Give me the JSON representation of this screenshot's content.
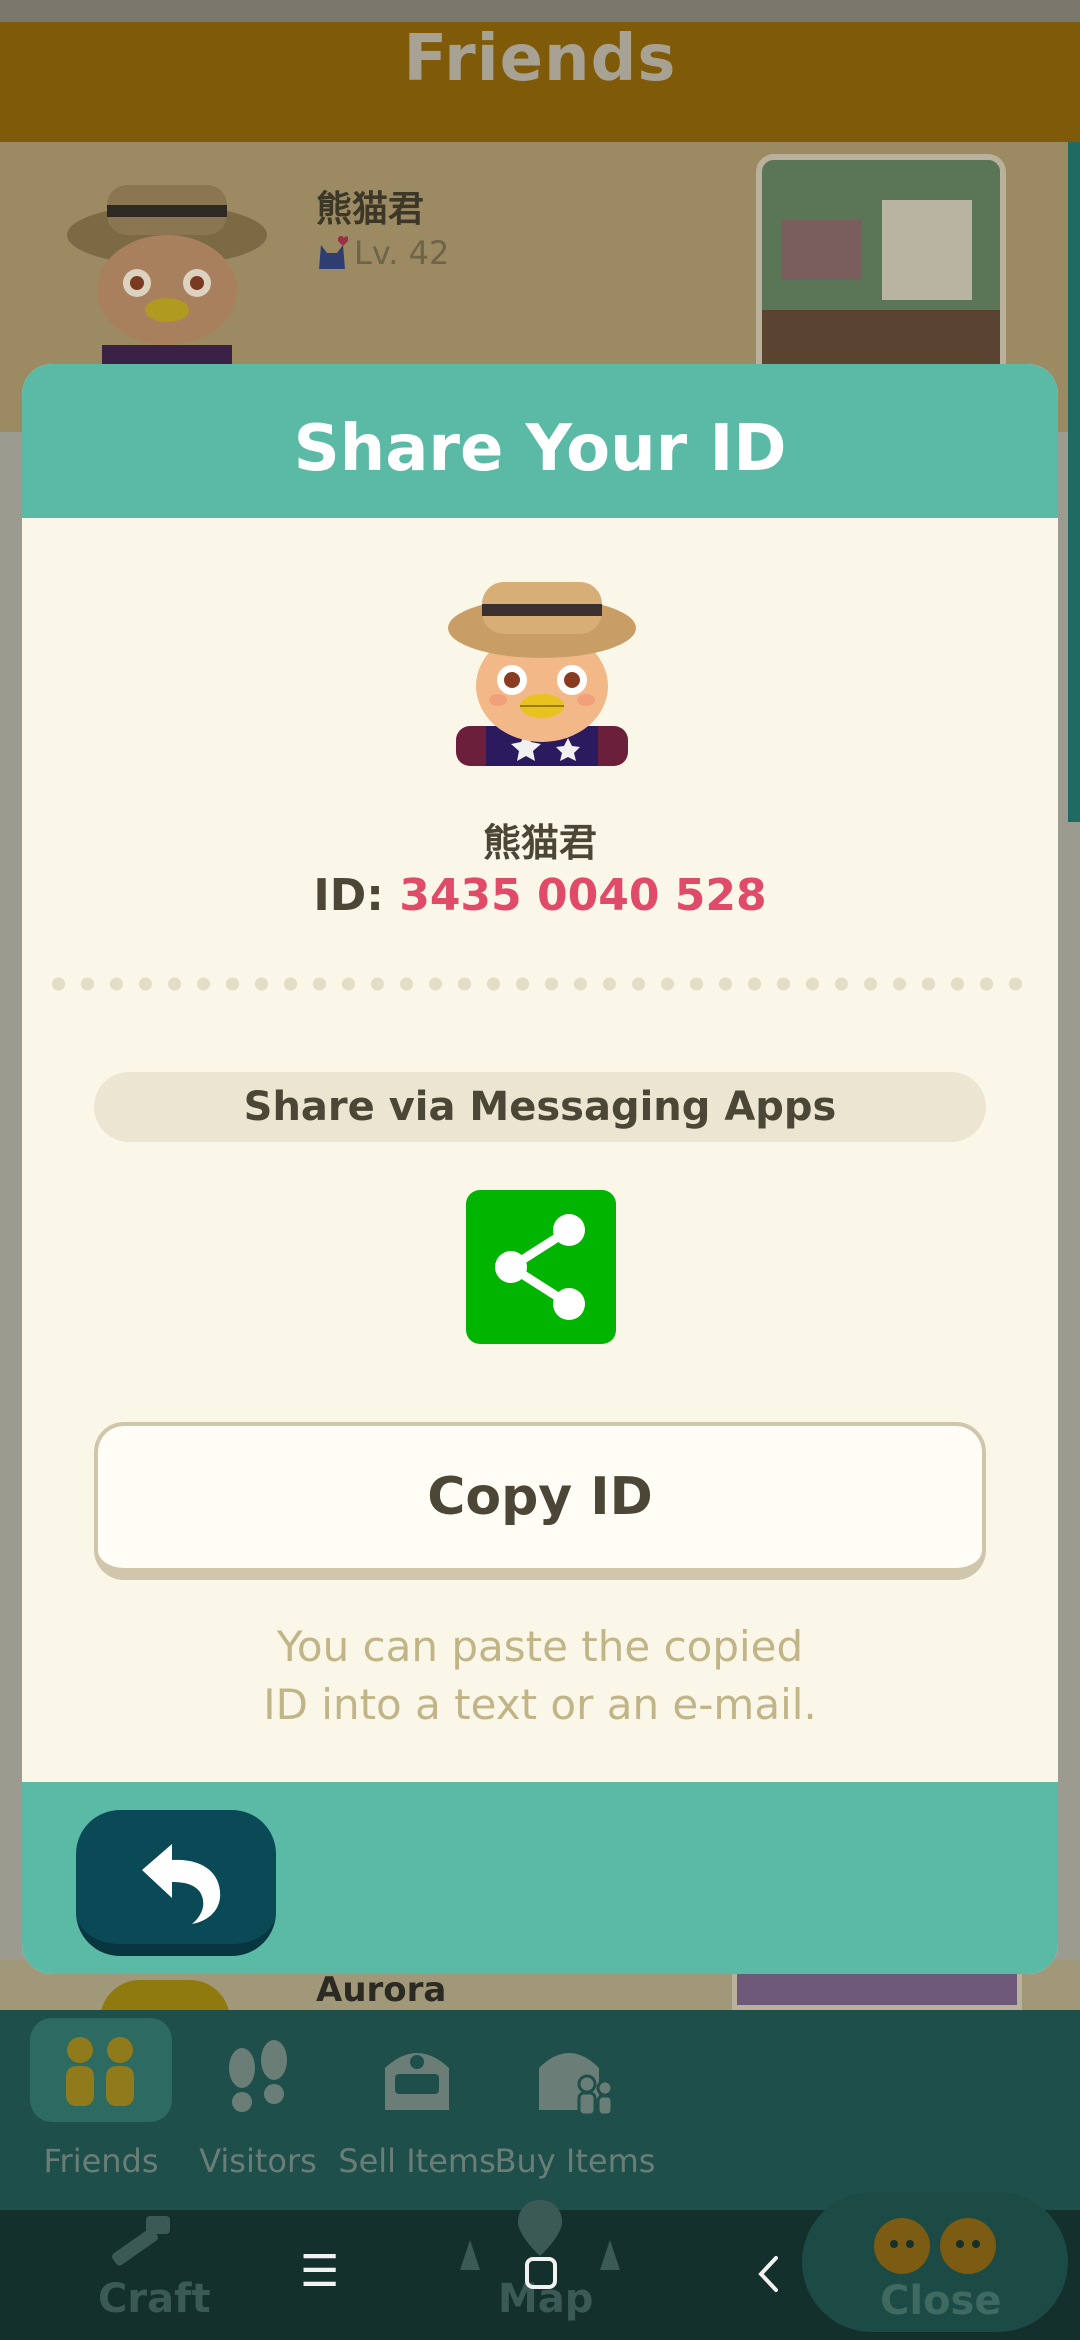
{
  "background": {
    "header_title": "Friends",
    "friend1": {
      "name": "熊猫君",
      "level": "Lv. 42"
    },
    "friend2": {
      "name": "Aurora"
    }
  },
  "tabs": [
    {
      "label": "Friends",
      "active": true
    },
    {
      "label": "Visitors"
    },
    {
      "label": "Sell Items"
    },
    {
      "label": "Buy Items"
    }
  ],
  "bottom_nav": {
    "craft": "Craft",
    "map": "Map",
    "close": "Close"
  },
  "modal": {
    "title": "Share Your ID",
    "player_name": "熊猫君",
    "id_label": "ID:",
    "id_value": "3435 0040 528",
    "share_label": "Share via Messaging Apps",
    "copy_label": "Copy ID",
    "hint": "You can paste the copied\nID into a text or an e-mail."
  },
  "colors": {
    "teal": "#5bbaa5",
    "cream": "#fbf7e8",
    "id_red": "#e04b6a",
    "share_green": "#00b400",
    "back_button": "#0a4a57"
  }
}
